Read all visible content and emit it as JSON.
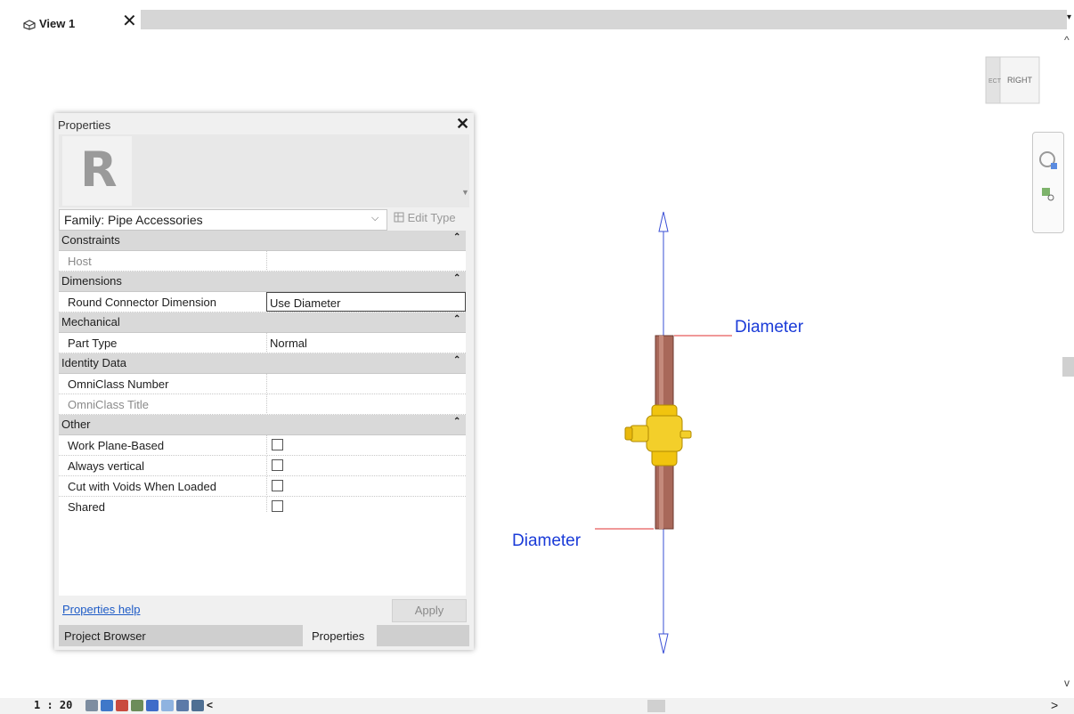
{
  "tab": {
    "label": "View 1",
    "close": "✕"
  },
  "viewcube": {
    "face_left": "ECT",
    "face_right": "RIGHT"
  },
  "properties": {
    "title": "Properties",
    "close": "✕",
    "family": "Family: Pipe Accessories",
    "edit_type": "Edit Type",
    "groups": [
      {
        "name": "Constraints",
        "rows": [
          {
            "name": "Host",
            "value": "",
            "dim": true
          }
        ]
      },
      {
        "name": "Dimensions",
        "rows": [
          {
            "name": "Round Connector Dimension",
            "value": "Use Diameter"
          }
        ]
      },
      {
        "name": "Mechanical",
        "rows": [
          {
            "name": "Part Type",
            "value": "Normal"
          }
        ]
      },
      {
        "name": "Identity Data",
        "rows": [
          {
            "name": "OmniClass Number",
            "value": ""
          },
          {
            "name": "OmniClass Title",
            "value": "",
            "dim": true
          }
        ]
      },
      {
        "name": "Other",
        "rows": [
          {
            "name": "Work Plane-Based",
            "checked": false
          },
          {
            "name": "Always vertical",
            "checked": false
          },
          {
            "name": "Cut with Voids When Loaded",
            "checked": false
          },
          {
            "name": "Shared",
            "checked": false
          }
        ]
      }
    ],
    "help_link": "Properties help",
    "apply": "Apply",
    "tabs": {
      "project_browser": "Project Browser",
      "properties": "Properties"
    }
  },
  "drawing": {
    "dim_top": "Diameter",
    "dim_bottom": "Diameter"
  },
  "statusbar": {
    "scale": "1 : 20",
    "more": "<"
  }
}
